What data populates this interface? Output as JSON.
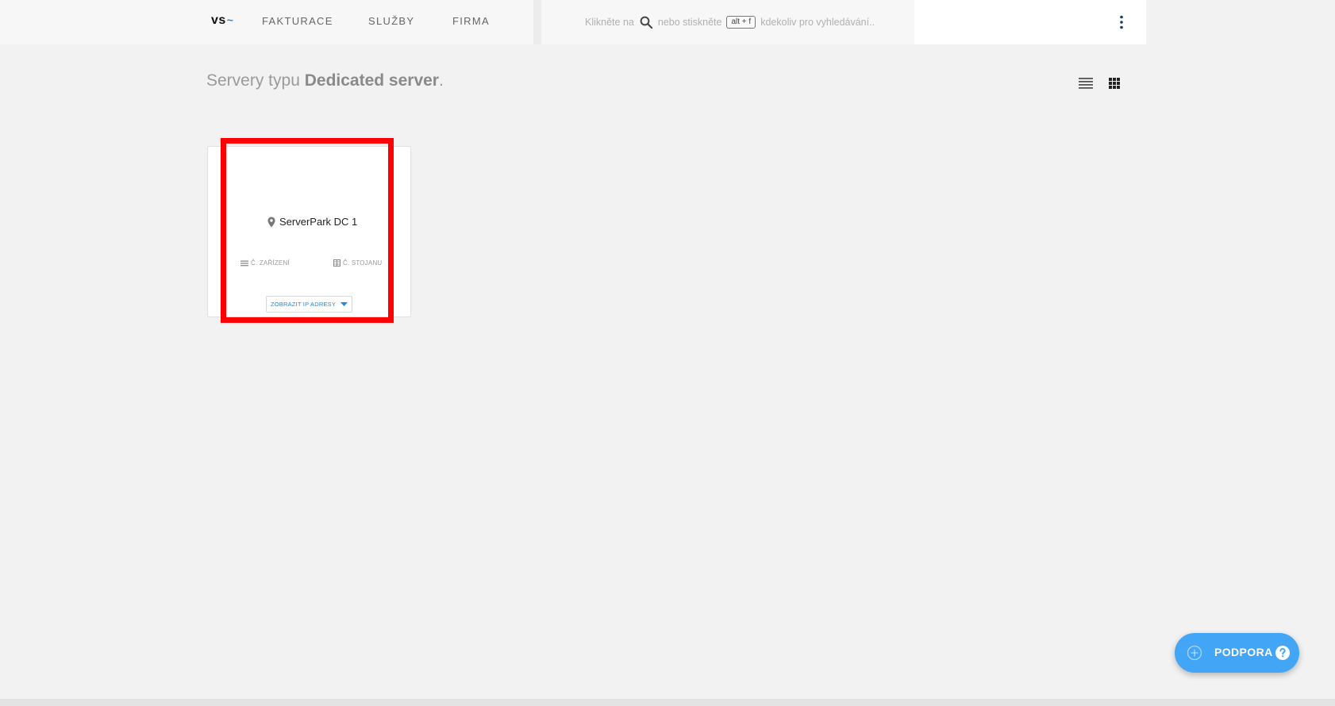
{
  "header": {
    "logo_text": "vs",
    "logo_tilde": "~",
    "nav": [
      {
        "label": "FAKTURACE"
      },
      {
        "label": "SLUŽBY"
      },
      {
        "label": "FIRMA"
      }
    ],
    "search": {
      "prefix": "Klikněte na",
      "middle": "nebo stiskněte",
      "shortcut": "alt + f",
      "suffix": "kdekoliv pro vyhledávání.."
    }
  },
  "page": {
    "title_prefix": "Servery typu ",
    "title_bold": "Dedicated server",
    "title_suffix": "."
  },
  "card": {
    "location": "ServerPark DC 1",
    "device_label": "Č. ZAŘÍZENÍ",
    "rack_label": "Č. STOJANU",
    "ip_button_label": "ZOBRAZIT IP ADRESY"
  },
  "support": {
    "label": "PODPORA"
  },
  "colors": {
    "accent": "#1e88e5",
    "fab": "#42a5f5",
    "highlight": "#ff0000",
    "background": "#f2f2f2"
  }
}
